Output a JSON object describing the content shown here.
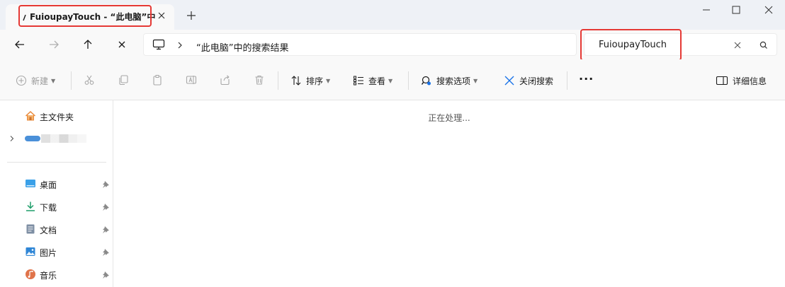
{
  "window": {
    "tab_title": "FuioupayTouch - “此电脑”中的搜索结果",
    "new_tab_label": "+",
    "accent": "#e53935"
  },
  "address": {
    "path": "“此电脑”中的搜索结果",
    "location_icon": "computer-icon"
  },
  "search": {
    "value": "FuioupayTouch"
  },
  "toolbar": {
    "new_label": "新建",
    "sort_label": "排序",
    "view_label": "查看",
    "search_options_label": "搜索选项",
    "close_search_label": "关闭搜索",
    "more_label": "···",
    "details_label": "详细信息"
  },
  "sidebar": {
    "items": [
      {
        "label": "主文件夹",
        "icon": "home-icon"
      },
      {
        "label": "",
        "icon": "onedrive-icon",
        "blurred": true
      },
      {
        "label": "桌面",
        "icon": "desktop-icon",
        "pinned": true
      },
      {
        "label": "下载",
        "icon": "download-icon",
        "pinned": true
      },
      {
        "label": "文档",
        "icon": "document-icon",
        "pinned": true
      },
      {
        "label": "图片",
        "icon": "pictures-icon",
        "pinned": true
      },
      {
        "label": "音乐",
        "icon": "music-icon",
        "pinned": true
      }
    ]
  },
  "content": {
    "status_text": "正在处理..."
  }
}
